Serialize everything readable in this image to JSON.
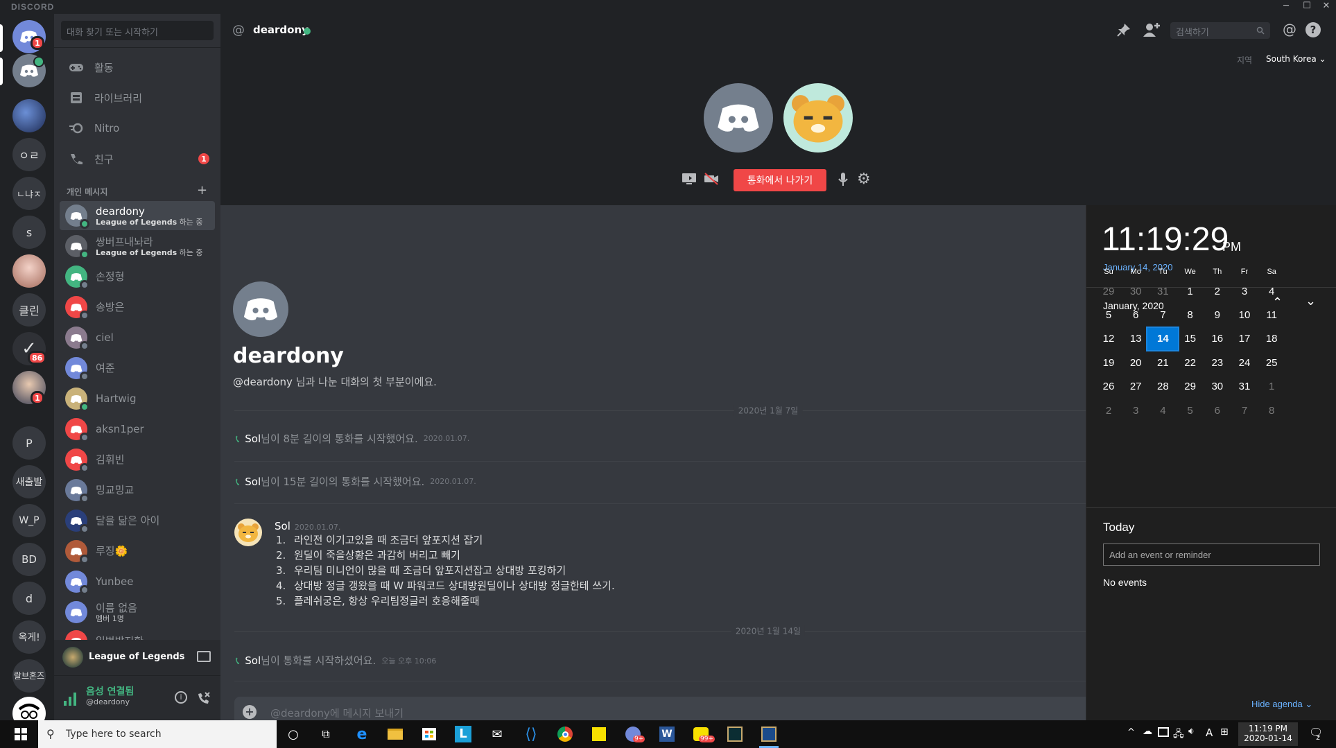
{
  "window": {
    "brand": "DISCORD",
    "minimize": "─",
    "maximize": "☐",
    "close": "✕"
  },
  "guilds": {
    "home_badge": "1",
    "items": [
      "ㅇㄹ",
      "ㄴ냐ㅈ",
      "s",
      "클린",
      "새출발",
      "W_P",
      "BD",
      "d",
      "옥게!",
      "랄브혼즈"
    ],
    "badge_86": "86",
    "badge_1b": "1",
    "p_label": "P"
  },
  "sidebar": {
    "search_placeholder": "대화 찾기 또는 시작하기",
    "nav": [
      {
        "label": "활동",
        "icon": "gamepad-icon"
      },
      {
        "label": "라이브러리",
        "icon": "library-icon"
      },
      {
        "label": "Nitro",
        "icon": "nitro-icon"
      },
      {
        "label": "친구",
        "icon": "friends-icon",
        "badge": "1"
      }
    ],
    "dm_header": "개인 메시지",
    "dm_add": "+",
    "dms": [
      {
        "name": "deardony",
        "sub_game": "League of Legends",
        "sub_rest": " 하는 중",
        "color": "#747f8d",
        "status": "#43b581",
        "active": true
      },
      {
        "name": "쌍버프내놔라",
        "sub_game": "League of Legends",
        "sub_rest": " 하는 중",
        "color": "#5c5f66",
        "status": "#43b581"
      },
      {
        "name": "손정형",
        "color": "#43b581",
        "status": "#747f8d"
      },
      {
        "name": "송방은",
        "color": "#f04747",
        "status": "#747f8d"
      },
      {
        "name": "ciel",
        "color": "#8b7b8e",
        "status": "#747f8d"
      },
      {
        "name": "여준",
        "color": "#7289da",
        "status": "#747f8d"
      },
      {
        "name": "Hartwig",
        "color": "#c9b27a",
        "status": "#43b581"
      },
      {
        "name": "aksn1per",
        "color": "#f04747",
        "status": "#747f8d"
      },
      {
        "name": "김휘빈",
        "color": "#f04747",
        "status": "#747f8d"
      },
      {
        "name": "밍교밍교",
        "color": "#6a7a9a",
        "status": "#747f8d"
      },
      {
        "name": "달을 닮은 아이",
        "color": "#2a3f7a",
        "status": "#747f8d"
      },
      {
        "name": "루징🌼",
        "color": "#b05a3a",
        "status": "#747f8d"
      },
      {
        "name": "Yunbee",
        "color": "#7289da",
        "status": "#747f8d"
      },
      {
        "name": "이름 없음",
        "sub_plain": "멤버 1명",
        "color": "#7289da",
        "status": ""
      },
      {
        "name": "일벽박지환",
        "color": "#f04747",
        "status": ""
      }
    ],
    "activity": {
      "game": "League of Legends"
    },
    "voice": {
      "status": "음성 연결됨",
      "user": "@deardony"
    }
  },
  "topbar": {
    "at": "@",
    "channel": "deardony",
    "search_placeholder": "검색하기",
    "region_label": "지역",
    "region_value": "South Korea"
  },
  "call": {
    "leave": "통화에서 나가기"
  },
  "chat": {
    "header_name": "deardony",
    "header_user": "@deardony",
    "header_rest": " 님과 나눈 대화의 첫 부분이에요.",
    "date1": "2020년 1월 7일",
    "sys1": {
      "user": "Sol",
      "text": "님이 8분 길이의 통화를 시작했어요.",
      "ts": "2020.01.07."
    },
    "sys2": {
      "user": "Sol",
      "text": "님이 15분 길이의 통화를 시작했어요.",
      "ts": "2020.01.07."
    },
    "msg": {
      "author": "Sol",
      "ts": "2020.01.07.",
      "lines": [
        {
          "n": "1.",
          "t": "라인전 이기고있을 때 조금더 앞포지션 잡기"
        },
        {
          "n": "2.",
          "t": "원딜이 죽을상황은 과감히 버리고 빼기"
        },
        {
          "n": "3.",
          "t": "우리팀 미니언이 많을 때 조금더 앞포지션잡고 상대방 포킹하기"
        },
        {
          "n": "4.",
          "t": "상대방 정글 갱왔을 때 W 파워코드 상대방원딜이나 상대방 정글한테 쓰기."
        },
        {
          "n": "5.",
          "t": "플레쉬궁은, 항상 우리팀정글러 호응해줄때"
        }
      ]
    },
    "date2": "2020년 1월 14일",
    "sys3": {
      "user": "Sol",
      "text": " 님이 통화를 시작하셨어요.",
      "ts": "오늘 오후 10:06"
    },
    "input_placeholder": "@deardony에 메시지 보내기"
  },
  "clock": {
    "time": "11:19:29",
    "ampm": "PM",
    "date": "January 14, 2020",
    "month": "January, 2020",
    "weekdays": [
      "Su",
      "Mo",
      "Tu",
      "We",
      "Th",
      "Fr",
      "Sa"
    ],
    "weeks": [
      [
        "29",
        "30",
        "31",
        "1",
        "2",
        "3",
        "4"
      ],
      [
        "5",
        "6",
        "7",
        "8",
        "9",
        "10",
        "11"
      ],
      [
        "12",
        "13",
        "14",
        "15",
        "16",
        "17",
        "18"
      ],
      [
        "19",
        "20",
        "21",
        "22",
        "23",
        "24",
        "25"
      ],
      [
        "26",
        "27",
        "28",
        "29",
        "30",
        "31",
        "1"
      ],
      [
        "2",
        "3",
        "4",
        "5",
        "6",
        "7",
        "8"
      ]
    ],
    "today_title": "Today",
    "event_placeholder": "Add an event or reminder",
    "no_events": "No events",
    "hide_agenda": "Hide agenda"
  },
  "taskbar": {
    "search_placeholder": "Type here to search",
    "time": "11:19 PM",
    "date": "2020-01-14",
    "lang": "A",
    "notif_count": "2",
    "icon_badge_1": "9+",
    "icon_badge_2": "99+"
  }
}
